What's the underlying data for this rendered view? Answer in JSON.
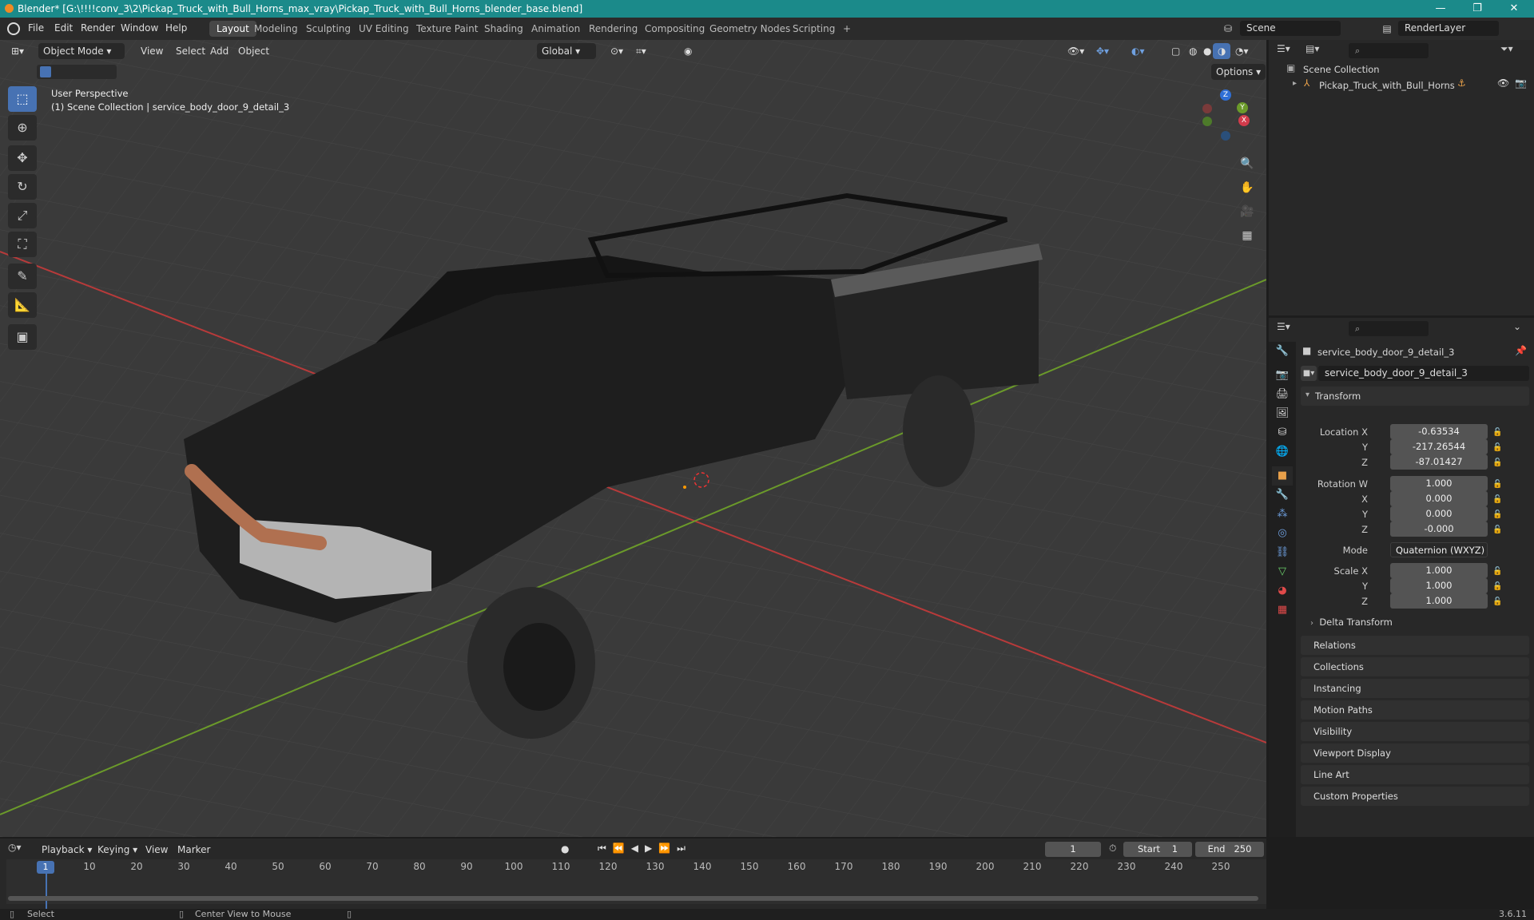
{
  "window": {
    "title": "Blender* [G:\\!!!!conv_3\\2\\Pickap_Truck_with_Bull_Horns_max_vray\\Pickap_Truck_with_Bull_Horns_blender_base.blend]",
    "minimize": "—",
    "maximize": "❐",
    "close": "✕"
  },
  "menubar": {
    "menus": [
      "File",
      "Edit",
      "Render",
      "Window",
      "Help"
    ],
    "workspaces": [
      "Layout",
      "Modeling",
      "Sculpting",
      "UV Editing",
      "Texture Paint",
      "Shading",
      "Animation",
      "Rendering",
      "Compositing",
      "Geometry Nodes",
      "Scripting"
    ],
    "active_workspace": "Layout",
    "add_tab": "+",
    "scene_label": "Scene",
    "view_layer_label": "RenderLayer"
  },
  "viewport": {
    "mode": "Object Mode",
    "menus": [
      "View",
      "Select",
      "Add",
      "Object"
    ],
    "orientation": "Global",
    "options": "Options",
    "perspective": "User Perspective",
    "collection_info": "(1) Scene Collection | service_body_door_9_detail_3",
    "gizmo": {
      "z": "Z",
      "y": "Y",
      "x": "X"
    }
  },
  "outliner": {
    "root": "Scene Collection",
    "item": "Pickap_Truck_with_Bull_Horns"
  },
  "properties": {
    "object_name": "service_body_door_9_detail_3",
    "data_name": "service_body_door_9_detail_3",
    "transform_title": "Transform",
    "location": {
      "label": "Location X",
      "x": "-0.63534",
      "y": "-217.26544",
      "z": "-87.01427"
    },
    "rotation": {
      "label": "Rotation W",
      "w": "1.000",
      "x": "0.000",
      "y": "0.000",
      "z": "-0.000"
    },
    "mode_label": "Mode",
    "mode_value": "Quaternion (WXYZ)",
    "scale": {
      "label": "Scale X",
      "x": "1.000",
      "y": "1.000",
      "z": "1.000"
    },
    "axis_y": "Y",
    "axis_z": "Z",
    "axis_x": "X",
    "delta": "Delta Transform",
    "sections": [
      "Relations",
      "Collections",
      "Instancing",
      "Motion Paths",
      "Visibility",
      "Viewport Display",
      "Line Art",
      "Custom Properties"
    ]
  },
  "timeline": {
    "menus": [
      "Playback",
      "Keying",
      "View",
      "Marker"
    ],
    "current_frame": "1",
    "start_label": "Start",
    "start": "1",
    "end_label": "End",
    "end": "250",
    "ticks": [
      "1",
      "10",
      "20",
      "30",
      "40",
      "50",
      "60",
      "70",
      "80",
      "90",
      "100",
      "110",
      "120",
      "130",
      "140",
      "150",
      "160",
      "170",
      "180",
      "190",
      "200",
      "210",
      "220",
      "230",
      "240",
      "250"
    ]
  },
  "statusbar": {
    "select": "Select",
    "center": "Center View to Mouse",
    "version": "3.6.11"
  },
  "colors": {
    "accent": "#4772b3",
    "title_bar": "#1b8a8a",
    "x_axis": "#b83a3a",
    "y_axis": "#6b9a2a"
  }
}
